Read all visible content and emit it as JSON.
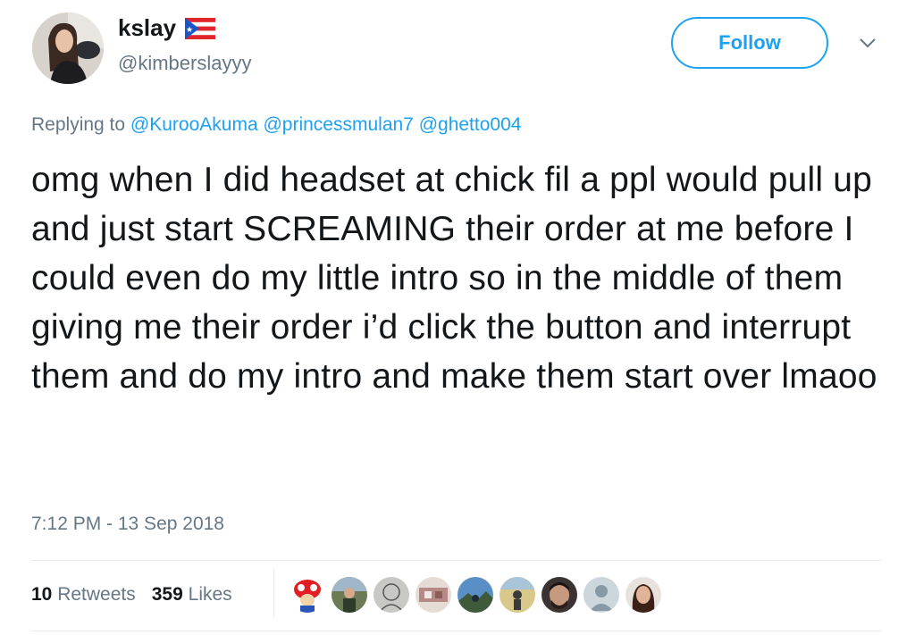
{
  "user": {
    "display_name": "kslay",
    "handle": "@kimberslayyy",
    "flag_icon": "puerto-rico-flag-icon"
  },
  "follow": {
    "label": "Follow",
    "color": "#1da1f2"
  },
  "reply": {
    "prefix": "Replying to",
    "mentions": [
      "@KurooAkuma",
      "@princessmulan7",
      "@ghetto004"
    ]
  },
  "tweet": {
    "text": "omg when I did headset at chick fil a ppl would pull up and just start SCREAMING their order at me before I could even do my little intro so in the middle of them giving me their order i’d click the button and interrupt them and do my intro and make them start over lmaoo",
    "timestamp": "7:12 PM - 13 Sep 2018"
  },
  "stats": {
    "retweets_count": "10",
    "retweets_label": "Retweets",
    "likes_count": "359",
    "likes_label": "Likes"
  },
  "likers": [
    {
      "icon": "toad-avatar"
    },
    {
      "icon": "outdoor-avatar"
    },
    {
      "icon": "sketch-avatar"
    },
    {
      "icon": "photo-avatar"
    },
    {
      "icon": "landscape-avatar"
    },
    {
      "icon": "field-avatar"
    },
    {
      "icon": "man-avatar"
    },
    {
      "icon": "default-avatar"
    },
    {
      "icon": "woman-avatar"
    }
  ]
}
